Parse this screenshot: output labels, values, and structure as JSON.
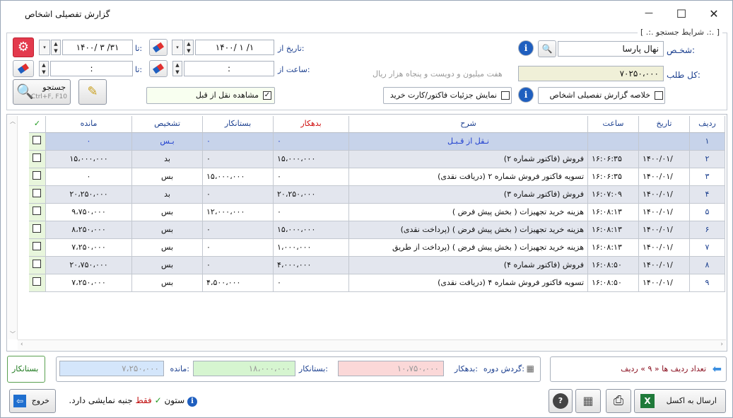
{
  "window": {
    "title": "گزارش تفصیلی اشخاص"
  },
  "search": {
    "group_title": "[ .:. شرایط جستجو .:. ]",
    "person_label": "شخـص:",
    "person_value": "نهال پارسا",
    "total_label": "کل طلب:",
    "total_value": "۷۰۲۵۰،۰۰۰",
    "total_words": "هفت میلیون و دویست و پنجاه هزار  ریال",
    "date_from_label": "تاریخ از:",
    "date_from_value": "۱۴۰۰/ ۱ /۱",
    "date_to_label": "تا:",
    "date_to_value": "۱۴۰۰/ ۳ /۳۱",
    "time_from_label": "ساعت از:",
    "time_from_value": ":",
    "time_to_label": "تا:",
    "time_to_value": ":",
    "search_button": "جستجو",
    "search_shortcut": "Ctrl+F, F10",
    "chk_summary": "خلاصه گزارش تفصیلی اشخاص",
    "chk_invoice": "نمایش جزئیات فاکتور/کارت خرید",
    "chk_carry": "مشاهده نقل از قبل"
  },
  "table": {
    "headers": {
      "row": "ردیف",
      "date": "تاریخ",
      "time": "ساعت",
      "desc": "شرح",
      "debit": "بدهکار",
      "credit": "بستانکار",
      "diag": "تشخیص",
      "balance": "مانده"
    },
    "rows": [
      {
        "row": "۱",
        "date": "",
        "time": "",
        "desc": "نـقل از قـبـل",
        "debit": "۰",
        "credit": "۰",
        "diag": "بـس",
        "balance": "۰"
      },
      {
        "row": "۲",
        "date": "۱۴۰۰/۰۱/",
        "time": "۱۶:۰۶:۳۵",
        "desc": "فروش (فاکتور شماره ۲)",
        "debit": "۱۵،۰۰۰،۰۰۰",
        "credit": "۰",
        "diag": "بد",
        "balance": "۱۵،۰۰۰،۰۰۰"
      },
      {
        "row": "۳",
        "date": "۱۴۰۰/۰۱/",
        "time": "۱۶:۰۶:۳۵",
        "desc": "تسویه فاکتور فروش شماره ۲ (دریافت نقدی)",
        "debit": "۰",
        "credit": "۱۵،۰۰۰،۰۰۰",
        "diag": "بس",
        "balance": "۰"
      },
      {
        "row": "۴",
        "date": "۱۴۰۰/۰۱/",
        "time": "۱۶:۰۷:۰۹",
        "desc": "فروش (فاکتور شماره ۳)",
        "debit": "۲۰،۲۵۰،۰۰۰",
        "credit": "۰",
        "diag": "بد",
        "balance": "۲۰،۲۵۰،۰۰۰"
      },
      {
        "row": "۵",
        "date": "۱۴۰۰/۰۱/",
        "time": "۱۶:۰۸:۱۳",
        "desc": "هزینه خرید تجهیزات ( بخش پیش فرض )",
        "debit": "۰",
        "credit": "۱۲،۰۰۰،۰۰۰",
        "diag": "بس",
        "balance": "۹،۷۵۰،۰۰۰"
      },
      {
        "row": "۶",
        "date": "۱۴۰۰/۰۱/",
        "time": "۱۶:۰۸:۱۳",
        "desc": "هزینه خرید تجهیزات ( بخش پیش فرض ) (پرداخت نقدی)",
        "debit": "۱۵،۰۰۰،۰۰۰",
        "credit": "۰",
        "diag": "بس",
        "balance": "۸،۲۵۰،۰۰۰"
      },
      {
        "row": "۷",
        "date": "۱۴۰۰/۰۱/",
        "time": "۱۶:۰۸:۱۳",
        "desc": "هزینه خرید تجهیزات ( بخش پیش فرض ) (پرداخت از طریق",
        "debit": "۱،۰۰۰،۰۰۰",
        "credit": "۰",
        "diag": "بس",
        "balance": "۷،۲۵۰،۰۰۰"
      },
      {
        "row": "۸",
        "date": "۱۴۰۰/۰۱/",
        "time": "۱۶:۰۸:۵۰",
        "desc": "فروش (فاکتور شماره ۴)",
        "debit": "۴،۰۰۰،۰۰۰",
        "credit": "۰",
        "diag": "بس",
        "balance": "۲۰،۷۵۰،۰۰۰"
      },
      {
        "row": "۹",
        "date": "۱۴۰۰/۰۱/",
        "time": "۱۶:۰۸:۵۰",
        "desc": "تسویه فاکتور فروش شماره ۴ (دریافت نقدی)",
        "debit": "۰",
        "credit": "۴،۵۰۰،۰۰۰",
        "diag": "بس",
        "balance": "۷،۲۵۰،۰۰۰"
      }
    ]
  },
  "footer": {
    "row_count_text": "تعداد ردیف ها « ۹ » ردیف",
    "period_label": "گردش دوره:",
    "debit_label": "بدهکار:",
    "debit_value": "۱۰،۷۵۰،۰۰۰",
    "credit_label": "بستانکار:",
    "credit_value": "۱۸،۰۰۰،۰۰۰",
    "balance_label": "مانده:",
    "balance_value": "۷،۲۵۰،۰۰۰",
    "status_badge": "بستانکار",
    "excel_button": "ارسال به اکسل",
    "exit_button": "خروج",
    "hint_col": "ستون",
    "hint_only": "فقط",
    "hint_rest": "جنبه نمایشی دارد."
  },
  "colors": {
    "debit_header": "#d01010",
    "check_green": "#1f9a1f",
    "total_bg": "#f0f0d8",
    "debit_bg": "#fbd8d8",
    "credit_bg": "#d6f5d0",
    "balance_bg": "#d4e6fb"
  }
}
